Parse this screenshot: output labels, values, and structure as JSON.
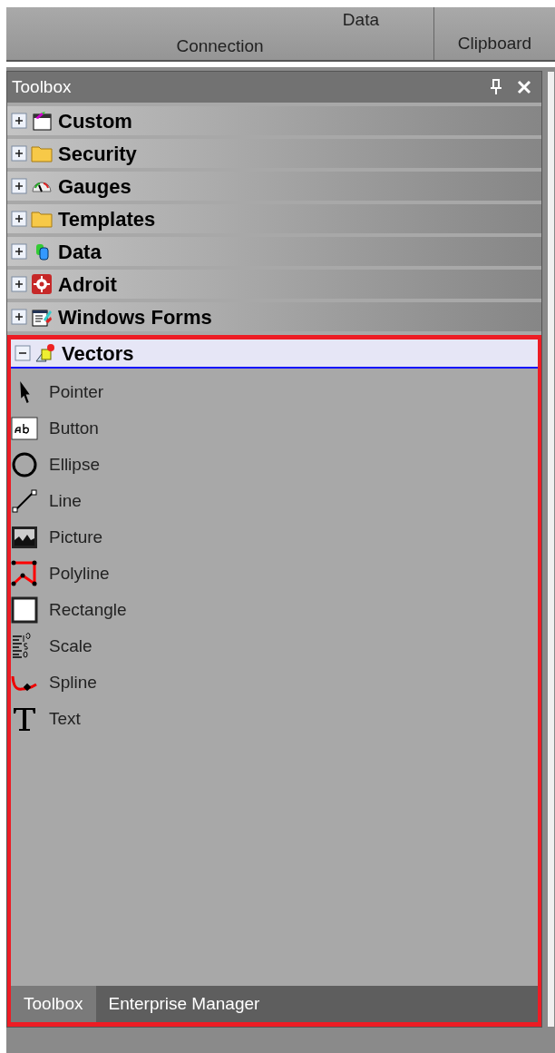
{
  "ribbon": {
    "groups": [
      {
        "label": "Data",
        "caption": "Connection"
      },
      {
        "caption": "Clipboard"
      }
    ]
  },
  "toolbox": {
    "title": "Toolbox",
    "categories": [
      {
        "name": "Custom",
        "expanded": false
      },
      {
        "name": "Security",
        "expanded": false
      },
      {
        "name": "Gauges",
        "expanded": false
      },
      {
        "name": "Templates",
        "expanded": false
      },
      {
        "name": "Data",
        "expanded": false
      },
      {
        "name": "Adroit",
        "expanded": false
      },
      {
        "name": "Windows Forms",
        "expanded": false
      },
      {
        "name": "Vectors",
        "expanded": true,
        "items": [
          "Pointer",
          "Button",
          "Ellipse",
          "Line",
          "Picture",
          "Polyline",
          "Rectangle",
          "Scale",
          "Spline",
          "Text"
        ]
      }
    ],
    "tabs": [
      {
        "label": "Toolbox",
        "selected": true
      },
      {
        "label": "Enterprise Manager",
        "selected": false
      }
    ]
  }
}
